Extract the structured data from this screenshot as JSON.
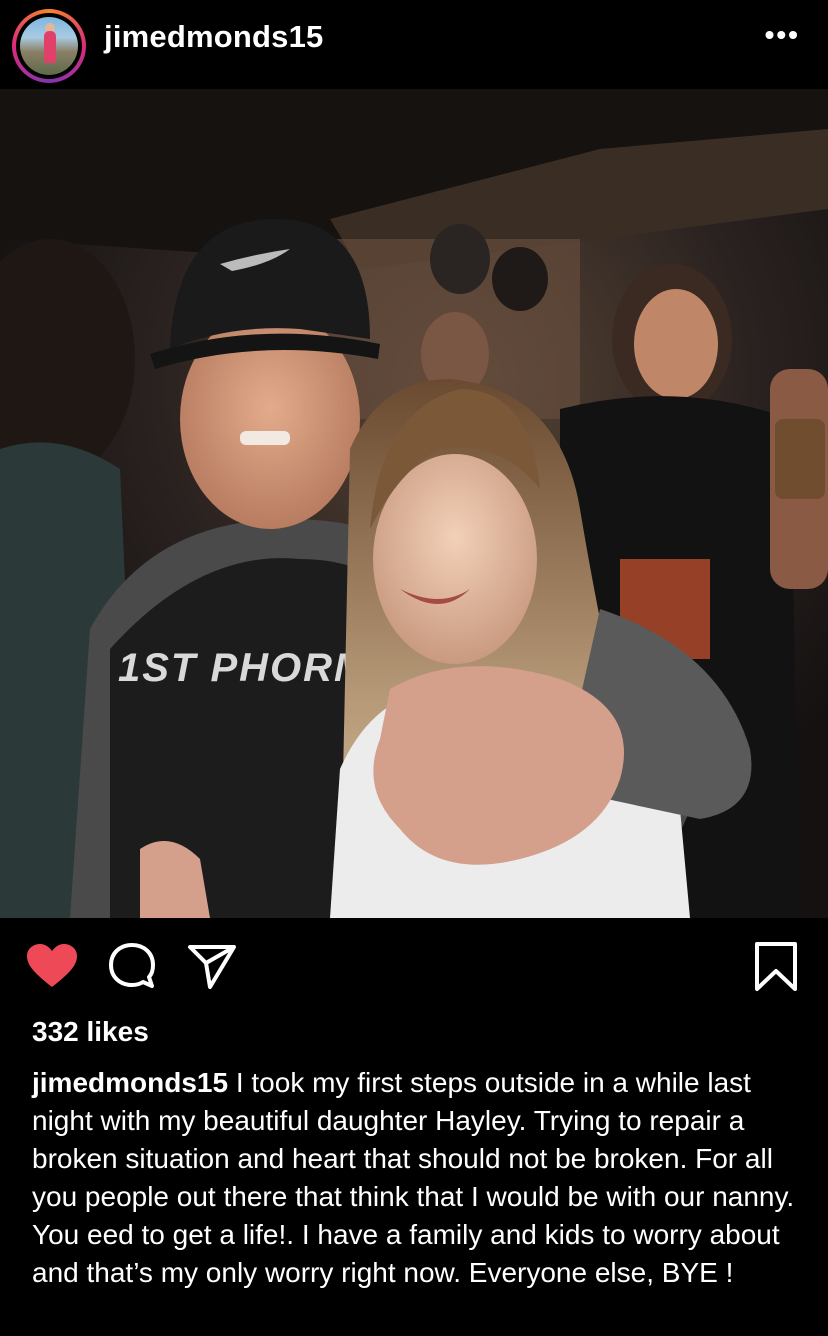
{
  "post": {
    "username": "jimedmonds15",
    "more_label": "•••",
    "photo_text": "1ST PHORM",
    "likes": "332 likes",
    "caption_user": "jimedmonds15",
    "caption_text": " I took my first steps outside in a while last night with my beautiful daughter Hayley.  Trying to repair a broken situation and heart  that should not be broken.  For all you people out there that think that I would be with our nanny.  You eed to get a life!. I have a family and kids to worry about and that’s  my only worry right now.  Everyone else, BYE !"
  },
  "actions": {
    "like_icon": "heart-icon",
    "comment_icon": "comment-icon",
    "share_icon": "share-icon",
    "save_icon": "bookmark-icon",
    "like_color": "#ed4956"
  }
}
